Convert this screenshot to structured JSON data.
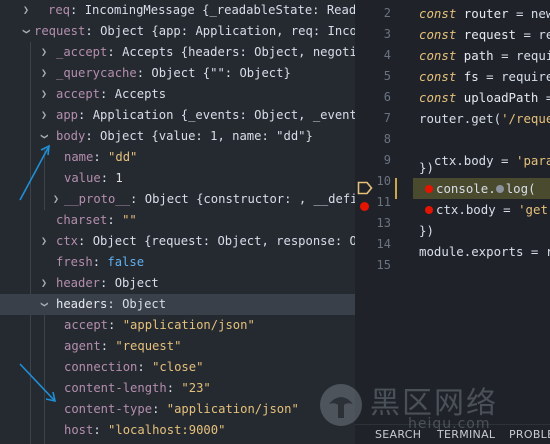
{
  "variables": {
    "rows": [
      {
        "key": "req",
        "value": "IncomingMessage {_readableState: ReadableS…"
      },
      {
        "key": "request",
        "value": "Object {app: Application, req: Incomin…"
      },
      {
        "key": "_accept",
        "value": "Accepts {headers: Object, negotiator…"
      },
      {
        "key": "_querycache",
        "value": "Object {\"\": Object}"
      },
      {
        "key": "accept",
        "value": "Accepts"
      },
      {
        "key": "app",
        "value": "Application {_events: Object, _eventsCou…"
      },
      {
        "key": "body",
        "value": "Object {value: 1, name: \"dd\"}"
      },
      {
        "key": "name",
        "value": "\"dd\""
      },
      {
        "key": "value",
        "value": "1"
      },
      {
        "key": "__proto__",
        "value": "Object {constructor: , __defineGe…"
      },
      {
        "key": "charset",
        "value": "\"\""
      },
      {
        "key": "ctx",
        "value": "Object {request: Object, response: Objec…"
      },
      {
        "key": "fresh",
        "value": "false"
      },
      {
        "key": "header",
        "value": "Object"
      },
      {
        "key": "headers",
        "value": "Object"
      },
      {
        "key": "accept",
        "value": "\"application/json\""
      },
      {
        "key": "agent",
        "value": "\"request\""
      },
      {
        "key": "connection",
        "value": "\"close\""
      },
      {
        "key": "content-length",
        "value": "\"23\""
      },
      {
        "key": "content-type",
        "value": "\"application/json\""
      },
      {
        "key": "host",
        "value": "\"localhost:9000\""
      }
    ]
  },
  "editor": {
    "line_numbers": [
      "2",
      "3",
      "4",
      "5",
      "6",
      "7",
      "8",
      "9",
      "10",
      "11",
      "12",
      "13",
      "14",
      "15"
    ],
    "current_line": "12",
    "lines": {
      "l2": {
        "kw": "const",
        "id": "router",
        "rest": " = new "
      },
      "l3": {
        "kw": "const",
        "id": "request",
        "rest": " = req"
      },
      "l4": {
        "kw": "const",
        "id": "path",
        "rest": " = requi"
      },
      "l5": {
        "kw": "const",
        "id": "fs",
        "rest": " = require("
      },
      "l6": {
        "kw": "const",
        "id": "uploadPath",
        "rest": " ="
      },
      "l7": {
        "pre": "router.get(",
        "str": "'/reques"
      },
      "l9": {
        "pre": "  ctx.body = ",
        "str": "'param"
      },
      "l10": {
        "pre": "})"
      },
      "l11": {
        "pre": "router.post(",
        "str": "'/reque"
      },
      "l12": {
        "pre": "console.",
        "post": "log("
      },
      "l13": {
        "pre": "ctx.body = ",
        "str": "'get"
      },
      "l14": {
        "pre": "})"
      },
      "l15": {
        "pre": "module.exports = ro"
      }
    }
  },
  "panel_tabs": {
    "search": "SEARCH",
    "terminal": "TERMINAL",
    "problems": "PROBLE"
  },
  "watermark": {
    "cn": "黑区网络",
    "url": "heiqu.com"
  },
  "colors": {
    "breakpoint": "#e51400",
    "key": "#b48ead",
    "string": "#e5c07b",
    "boolean": "#61afef",
    "arrow": "#1f8fd6"
  }
}
